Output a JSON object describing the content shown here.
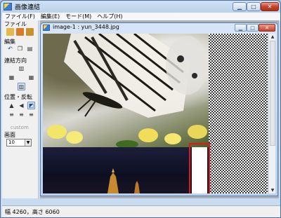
{
  "window": {
    "title": "画像連結"
  },
  "menu": [
    {
      "label": "ファイル(F)"
    },
    {
      "label": "編集(E)"
    },
    {
      "label": "モード(M)"
    },
    {
      "label": "ヘルプ(H)"
    }
  ],
  "panel": {
    "file_label": "ファイル",
    "edit_label": "編集",
    "direction_label": "連結方向",
    "position_label": "位置・反転",
    "custom_label": "custom",
    "zoom_label": "画面",
    "zoom_value": "10"
  },
  "child": {
    "title": "image-1 : yun_3448.jpg"
  },
  "status": {
    "text": "幅 4260，高さ 6060"
  },
  "colors": {
    "highlight_box": "#e01818"
  }
}
